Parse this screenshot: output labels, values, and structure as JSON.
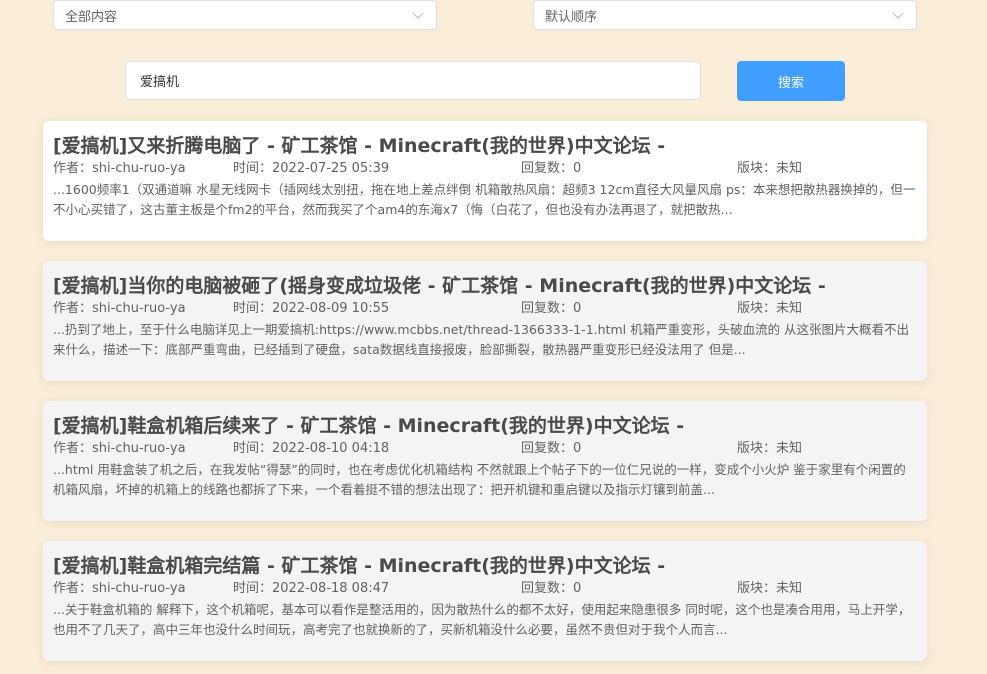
{
  "filters": {
    "content_select": "全部内容",
    "order_select": "默认顺序"
  },
  "search": {
    "value": "爱搞机",
    "button_label": "搜索"
  },
  "colors": {
    "page_bg": "#faeed9",
    "accent": "#409eff"
  },
  "icons": {
    "dropdown": "chevron-down-icon"
  },
  "results": [
    {
      "title": "[爱搞机]又来折腾电脑了 - 矿工茶馆 - Minecraft(我的世界)中文论坛 -",
      "author": "作者：shi-chu-ruo-ya",
      "time": "时间：2022-07-25 05:39",
      "replies": "回复数：0",
      "board": "版块：未知",
      "snippet": "...1600频率1（双通道嘛 水星无线网卡（插网线太别扭，拖在地上差点绊倒 机箱散热风扇：超频3 12cm直径大风量风扇 ps：本来想把散热器换掉的，但一不小心买错了，这古董主板是个fm2的平台，然而我买了个am4的东海x7（悔（白花了，但也没有办法再退了，就把散热..."
    },
    {
      "title": "[爱搞机]当你的电脑被砸了(摇身变成垃圾佬 - 矿工茶馆 - Minecraft(我的世界)中文论坛 -",
      "author": "作者：shi-chu-ruo-ya",
      "time": "时间：2022-08-09 10:55",
      "replies": "回复数：0",
      "board": "版块：未知",
      "snippet": "...扔到了地上，至于什么电脑详见上一期爱搞机:https://www.mcbbs.net/thread-1366333-1-1.html 机箱严重变形，头破血流的 从这张图片大概看不出来什么，描述一下：底部严重弯曲，已经插到了硬盘，sata数据线直接报废，脸部撕裂，散热器严重变形已经没法用了 但是..."
    },
    {
      "title": "[爱搞机]鞋盒机箱后续来了 - 矿工茶馆 - Minecraft(我的世界)中文论坛 -",
      "author": "作者：shi-chu-ruo-ya",
      "time": "时间：2022-08-10 04:18",
      "replies": "回复数：0",
      "board": "版块：未知",
      "snippet": "...html 用鞋盒装了机之后，在我发帖“得瑟”的同时，也在考虑优化机箱结构 不然就跟上个帖子下的一位仁兄说的一样，变成个小火炉 鉴于家里有个闲置的机箱风扇，坏掉的机箱上的线路也都拆了下来，一个看着挺不错的想法出现了：把开机键和重启键以及指示灯镶到前盖..."
    },
    {
      "title": "[爱搞机]鞋盒机箱完结篇 - 矿工茶馆 - Minecraft(我的世界)中文论坛 -",
      "author": "作者：shi-chu-ruo-ya",
      "time": "时间：2022-08-18 08:47",
      "replies": "回复数：0",
      "board": "版块：未知",
      "snippet": "...关于鞋盒机箱的 解释下，这个机箱呢，基本可以看作是整活用的，因为散热什么的都不太好，使用起来隐患很多 同时呢，这个也是凑合用用，马上开学，也用不了几天了，高中三年也没什么时间玩，高考完了也就换新的了，买新机箱没什么必要，虽然不贵但对于我个人而言..."
    }
  ]
}
